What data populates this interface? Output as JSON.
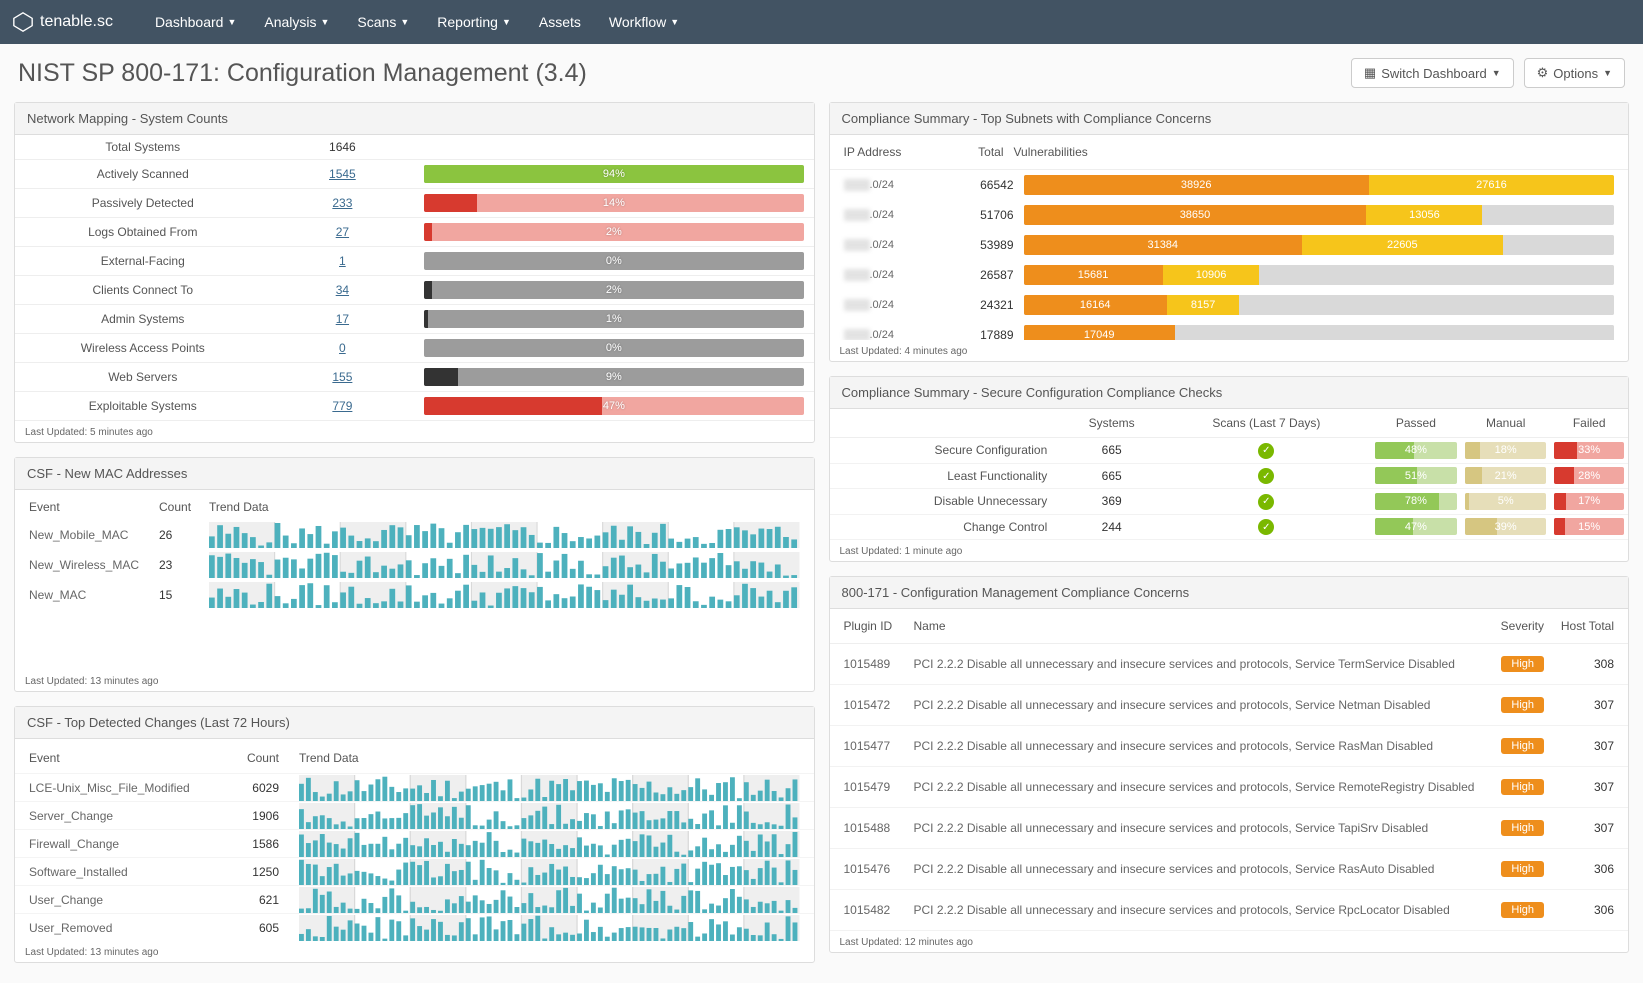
{
  "brand": "tenable.sc",
  "nav": [
    "Dashboard",
    "Analysis",
    "Scans",
    "Reporting",
    "Assets",
    "Workflow"
  ],
  "nav_has_caret": [
    true,
    true,
    true,
    true,
    false,
    true
  ],
  "page_title": "NIST SP 800-171: Configuration Management (3.4)",
  "buttons": {
    "switch": "Switch Dashboard",
    "options": "Options"
  },
  "network_mapping": {
    "title": "Network Mapping - System Counts",
    "rows": [
      {
        "label": "Total Systems",
        "count": "1646",
        "pct": null,
        "link": false
      },
      {
        "label": "Actively Scanned",
        "count": "1545",
        "pct": 94,
        "link": true,
        "fill": "#8bc43f",
        "track": "#8bc43f"
      },
      {
        "label": "Passively Detected",
        "count": "233",
        "pct": 14,
        "link": true,
        "fill": "#d73a2f",
        "track": "#f1a6a0"
      },
      {
        "label": "Logs Obtained From",
        "count": "27",
        "pct": 2,
        "link": true,
        "fill": "#d73a2f",
        "track": "#f1a6a0"
      },
      {
        "label": "External-Facing",
        "count": "1",
        "pct": 0,
        "link": true,
        "fill": "#333",
        "track": "#9c9c9c"
      },
      {
        "label": "Clients Connect To",
        "count": "34",
        "pct": 2,
        "link": true,
        "fill": "#333",
        "track": "#9c9c9c"
      },
      {
        "label": "Admin Systems",
        "count": "17",
        "pct": 1,
        "link": true,
        "fill": "#333",
        "track": "#9c9c9c"
      },
      {
        "label": "Wireless Access Points",
        "count": "0",
        "pct": 0,
        "link": true,
        "fill": "#333",
        "track": "#9c9c9c"
      },
      {
        "label": "Web Servers",
        "count": "155",
        "pct": 9,
        "link": true,
        "fill": "#333",
        "track": "#9c9c9c"
      },
      {
        "label": "Exploitable Systems",
        "count": "779",
        "pct": 47,
        "link": true,
        "fill": "#d73a2f",
        "track": "#f1a6a0"
      }
    ],
    "updated": "Last Updated: 5 minutes ago"
  },
  "mac": {
    "title": "CSF - New MAC Addresses",
    "headers": {
      "event": "Event",
      "count": "Count",
      "trend": "Trend Data"
    },
    "rows": [
      {
        "event": "New_Mobile_MAC",
        "count": "26"
      },
      {
        "event": "New_Wireless_MAC",
        "count": "23"
      },
      {
        "event": "New_MAC",
        "count": "15"
      }
    ],
    "updated": "Last Updated: 13 minutes ago"
  },
  "changes": {
    "title": "CSF - Top Detected Changes (Last 72 Hours)",
    "headers": {
      "event": "Event",
      "count": "Count",
      "trend": "Trend Data"
    },
    "rows": [
      {
        "event": "LCE-Unix_Misc_File_Modified",
        "count": "6029"
      },
      {
        "event": "Server_Change",
        "count": "1906"
      },
      {
        "event": "Firewall_Change",
        "count": "1586"
      },
      {
        "event": "Software_Installed",
        "count": "1250"
      },
      {
        "event": "User_Change",
        "count": "621"
      },
      {
        "event": "User_Removed",
        "count": "605"
      }
    ],
    "updated": "Last Updated: 13 minutes ago"
  },
  "subnets": {
    "title": "Compliance Summary - Top Subnets with Compliance Concerns",
    "headers": {
      "ip": "IP Address",
      "total": "Total",
      "vuln": "Vulnerabilities"
    },
    "max": 66542,
    "rows": [
      {
        "ip_suffix": ".0/24",
        "total": 66542,
        "a": 38926,
        "b": 27616
      },
      {
        "ip_suffix": ".0/24",
        "total": 51706,
        "a": 38650,
        "b": 13056
      },
      {
        "ip_suffix": ".0/24",
        "total": 53989,
        "a": 31384,
        "b": 22605
      },
      {
        "ip_suffix": ".0/24",
        "total": 26587,
        "a": 15681,
        "b": 10906
      },
      {
        "ip_suffix": ".0/24",
        "total": 24321,
        "a": 16164,
        "b": 8157
      },
      {
        "ip_suffix": ".0/24",
        "total": 17889,
        "a": 17049,
        "b": 0
      }
    ],
    "updated": "Last Updated: 4 minutes ago"
  },
  "checks": {
    "title": "Compliance Summary - Secure Configuration Compliance Checks",
    "headers": [
      "",
      "Systems",
      "Scans (Last 7 Days)",
      "Passed",
      "Manual",
      "Failed"
    ],
    "rows": [
      {
        "label": "Secure Configuration",
        "systems": "665",
        "passed": 48,
        "manual": 18,
        "failed": 33
      },
      {
        "label": "Least Functionality",
        "systems": "665",
        "passed": 51,
        "manual": 21,
        "failed": 28
      },
      {
        "label": "Disable Unnecessary",
        "systems": "369",
        "passed": 78,
        "manual": 5,
        "failed": 17
      },
      {
        "label": "Change Control",
        "systems": "244",
        "passed": 47,
        "manual": 39,
        "failed": 15
      }
    ],
    "updated": "Last Updated: 1 minute ago"
  },
  "concerns": {
    "title": "800-171 - Configuration Management Compliance Concerns",
    "headers": {
      "plugin": "Plugin ID",
      "name": "Name",
      "sev": "Severity",
      "total": "Host Total"
    },
    "rows": [
      {
        "id": "1015489",
        "name": "PCI 2.2.2 Disable all unnecessary and insecure services and protocols, Service TermService Disabled",
        "sev": "High",
        "total": "308"
      },
      {
        "id": "1015472",
        "name": "PCI 2.2.2 Disable all unnecessary and insecure services and protocols, Service Netman Disabled",
        "sev": "High",
        "total": "307"
      },
      {
        "id": "1015477",
        "name": "PCI 2.2.2 Disable all unnecessary and insecure services and protocols, Service RasMan Disabled",
        "sev": "High",
        "total": "307"
      },
      {
        "id": "1015479",
        "name": "PCI 2.2.2 Disable all unnecessary and insecure services and protocols, Service RemoteRegistry Disabled",
        "sev": "High",
        "total": "307"
      },
      {
        "id": "1015488",
        "name": "PCI 2.2.2 Disable all unnecessary and insecure services and protocols, Service TapiSrv Disabled",
        "sev": "High",
        "total": "307"
      },
      {
        "id": "1015476",
        "name": "PCI 2.2.2 Disable all unnecessary and insecure services and protocols, Service RasAuto Disabled",
        "sev": "High",
        "total": "306"
      },
      {
        "id": "1015482",
        "name": "PCI 2.2.2 Disable all unnecessary and insecure services and protocols, Service RpcLocator Disabled",
        "sev": "High",
        "total": "306"
      }
    ],
    "updated": "Last Updated: 12 minutes ago"
  },
  "colors": {
    "orange": "#ee8e1c",
    "yellow": "#f6c51b",
    "green_bar": "#93c858",
    "green_track": "#c8e0a8",
    "tan_bar": "#d6c681",
    "tan_track": "#e6deb9",
    "red_bar": "#d73a2f",
    "red_track": "#f1a6a0"
  }
}
